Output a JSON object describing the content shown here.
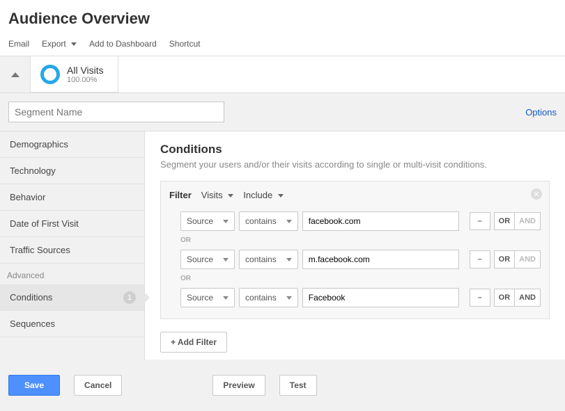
{
  "header": {
    "title": "Audience Overview",
    "toolbar": {
      "email": "Email",
      "export": "Export",
      "add_to_dashboard": "Add to Dashboard",
      "shortcut": "Shortcut"
    }
  },
  "segment": {
    "name": "All Visits",
    "percent": "100.00%",
    "name_placeholder": "Segment Name",
    "options_label": "Options"
  },
  "sidebar": {
    "basic": [
      {
        "label": "Demographics"
      },
      {
        "label": "Technology"
      },
      {
        "label": "Behavior"
      },
      {
        "label": "Date of First Visit"
      },
      {
        "label": "Traffic Sources"
      }
    ],
    "advanced_label": "Advanced",
    "advanced": [
      {
        "label": "Conditions",
        "badge": "1",
        "active": true
      },
      {
        "label": "Sequences"
      }
    ]
  },
  "conditions": {
    "title": "Conditions",
    "desc": "Segment your users and/or their visits according to single or multi-visit conditions.",
    "filter_label": "Filter",
    "scope": "Visits",
    "mode": "Include",
    "rows": [
      {
        "dim": "Source",
        "op": "contains",
        "val": "facebook.com",
        "and_disabled": true
      },
      {
        "dim": "Source",
        "op": "contains",
        "val": "m.facebook.com",
        "and_disabled": true
      },
      {
        "dim": "Source",
        "op": "contains",
        "val": "Facebook",
        "and_disabled": false
      }
    ],
    "or_label": "OR",
    "and_label": "AND",
    "remove_label": "–",
    "sep_label": "OR",
    "add_filter": "+ Add Filter"
  },
  "footer": {
    "save": "Save",
    "cancel": "Cancel",
    "preview": "Preview",
    "test": "Test"
  }
}
